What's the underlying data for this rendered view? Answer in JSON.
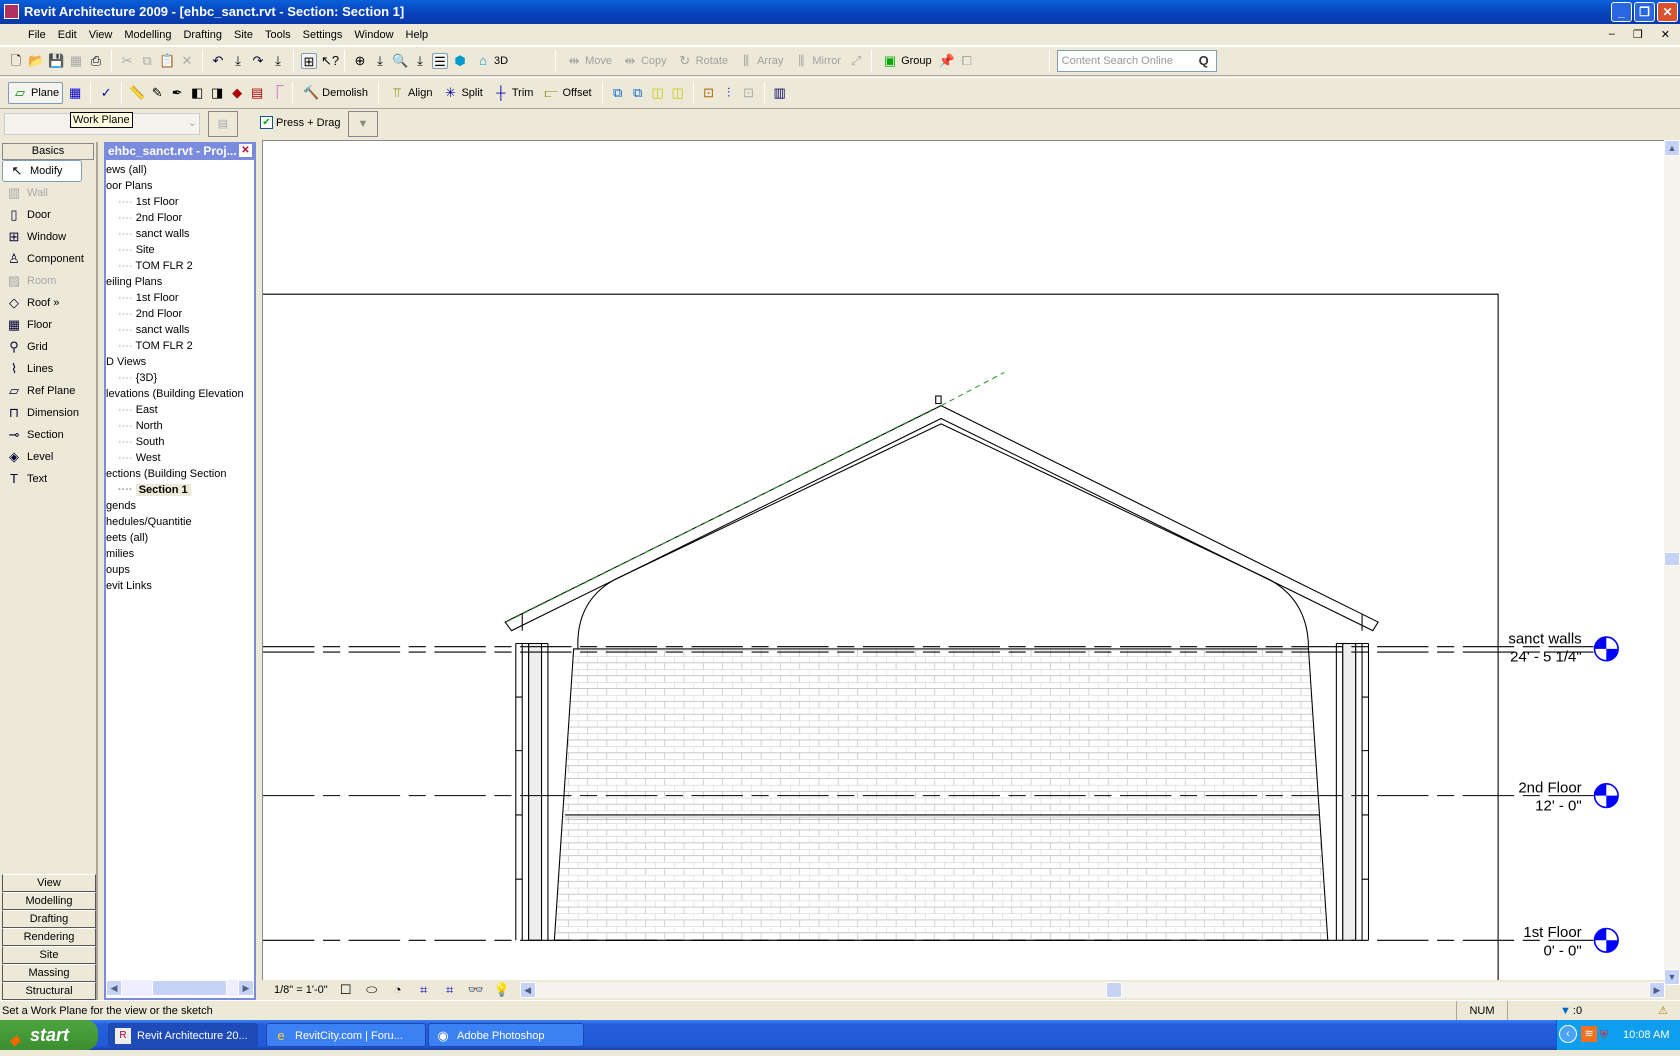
{
  "window": {
    "title": "Revit Architecture 2009 - [ehbc_sanct.rvt - Section: Section 1]"
  },
  "menu": [
    "File",
    "Edit",
    "View",
    "Modelling",
    "Drafting",
    "Site",
    "Tools",
    "Settings",
    "Window",
    "Help"
  ],
  "toolbar1": {
    "view3d_label": "3D",
    "edit_tools": [
      "Move",
      "Copy",
      "Rotate",
      "Array",
      "Mirror"
    ],
    "group_label": "Group",
    "search_placeholder": "Content Search Online"
  },
  "toolbar2": {
    "plane_label": "Plane",
    "demolish_label": "Demolish",
    "align_label": "Align",
    "split_label": "Split",
    "trim_label": "Trim",
    "offset_label": "Offset"
  },
  "options": {
    "tooltip": "Work Plane",
    "press_drag_label": "Press + Drag",
    "press_drag_checked": true
  },
  "designbar": {
    "active_tab": "Basics",
    "items": [
      {
        "label": "Modify",
        "icon": "arrow-icon",
        "state": "selected"
      },
      {
        "label": "Wall",
        "icon": "wall-icon",
        "state": "disabled"
      },
      {
        "label": "Door",
        "icon": "door-icon",
        "state": ""
      },
      {
        "label": "Window",
        "icon": "window-icon",
        "state": ""
      },
      {
        "label": "Component",
        "icon": "component-icon",
        "state": ""
      },
      {
        "label": "Room",
        "icon": "room-icon",
        "state": "disabled"
      },
      {
        "label": "Roof »",
        "icon": "roof-icon",
        "state": ""
      },
      {
        "label": "Floor",
        "icon": "floor-icon",
        "state": ""
      },
      {
        "label": "Grid",
        "icon": "grid-icon",
        "state": ""
      },
      {
        "label": "Lines",
        "icon": "lines-icon",
        "state": ""
      },
      {
        "label": "Ref Plane",
        "icon": "ref-plane-icon",
        "state": ""
      },
      {
        "label": "Dimension",
        "icon": "dimension-icon",
        "state": ""
      },
      {
        "label": "Section",
        "icon": "section-icon",
        "state": ""
      },
      {
        "label": "Level",
        "icon": "level-icon",
        "state": ""
      },
      {
        "label": "Text",
        "icon": "text-icon",
        "state": ""
      }
    ],
    "tabs": [
      "View",
      "Modelling",
      "Drafting",
      "Rendering",
      "Site",
      "Massing",
      "Structural"
    ]
  },
  "browser": {
    "title": "ehbc_sanct.rvt - Proj...",
    "tree": [
      {
        "label": "ews (all)",
        "level": 1
      },
      {
        "label": "oor Plans",
        "level": 1
      },
      {
        "label": "1st Floor",
        "level": 2
      },
      {
        "label": "2nd Floor",
        "level": 2
      },
      {
        "label": "sanct walls",
        "level": 2
      },
      {
        "label": "Site",
        "level": 2
      },
      {
        "label": "TOM FLR 2",
        "level": 2
      },
      {
        "label": "eiling Plans",
        "level": 1
      },
      {
        "label": "1st Floor",
        "level": 2
      },
      {
        "label": "2nd Floor",
        "level": 2
      },
      {
        "label": "sanct walls",
        "level": 2
      },
      {
        "label": "TOM FLR 2",
        "level": 2
      },
      {
        "label": "D Views",
        "level": 1
      },
      {
        "label": "{3D}",
        "level": 2
      },
      {
        "label": "levations (Building Elevation",
        "level": 1
      },
      {
        "label": "East",
        "level": 2
      },
      {
        "label": "North",
        "level": 2
      },
      {
        "label": "South",
        "level": 2
      },
      {
        "label": "West",
        "level": 2
      },
      {
        "label": "ections (Building Section",
        "level": 1
      },
      {
        "label": "Section 1",
        "level": 2,
        "selected": true
      },
      {
        "label": "gends",
        "level": 1
      },
      {
        "label": "hedules/Quantitie",
        "level": 1
      },
      {
        "label": "eets (all)",
        "level": 1
      },
      {
        "label": "milies",
        "level": 1
      },
      {
        "label": "oups",
        "level": 1
      },
      {
        "label": "evit Links",
        "level": 1
      }
    ]
  },
  "levels": [
    {
      "name": "sanct walls",
      "elevation": "24' - 5 1/4\""
    },
    {
      "name": "2nd Floor",
      "elevation": "12' - 0\""
    },
    {
      "name": "1st Floor",
      "elevation": "0' - 0\""
    }
  ],
  "viewbar": {
    "scale": "1/8\" = 1'-0\""
  },
  "status": {
    "message": "Set a Work Plane for the view or the sketch",
    "num": "NUM",
    "filter_count": ":0"
  },
  "taskbar": {
    "start_label": "start",
    "tasks": [
      "Revit Architecture 20...",
      "RevitCity.com | Foru...",
      "Adobe Photoshop"
    ],
    "clock": "10:08 AM"
  }
}
